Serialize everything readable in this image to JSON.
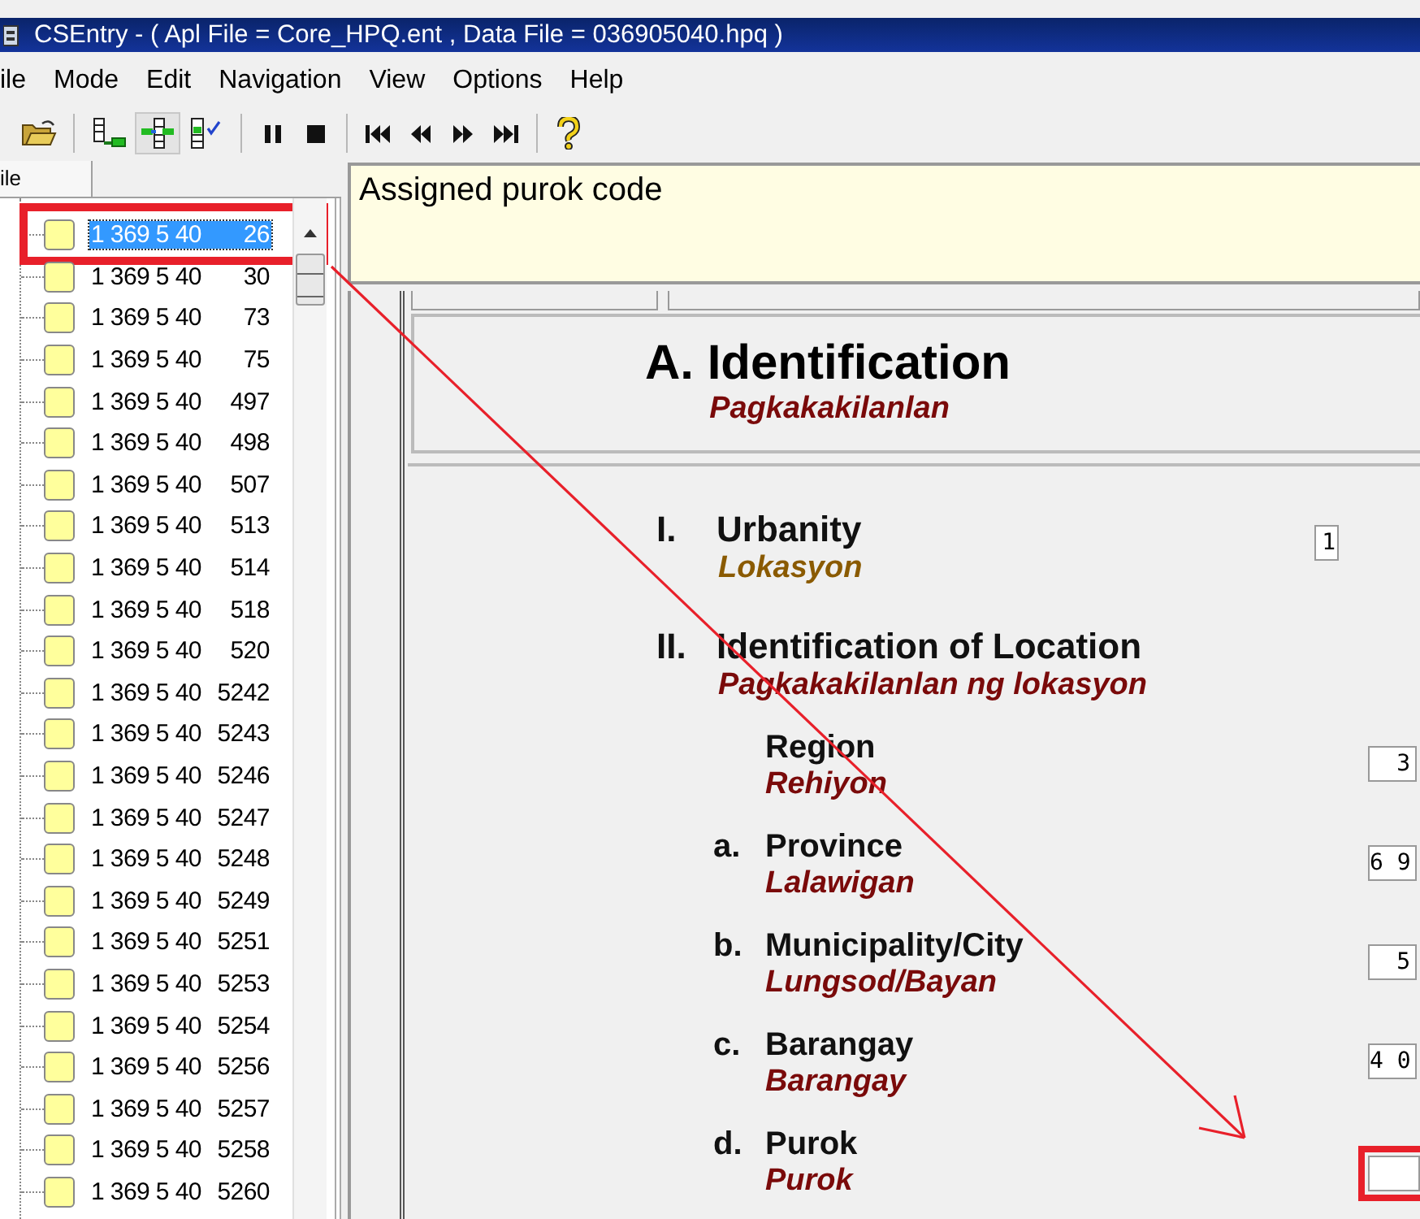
{
  "window": {
    "title": "CSEntry - ( Apl File = Core_HPQ.ent , Data File = 036905040.hpq )"
  },
  "menu": [
    "ile",
    "Mode",
    "Edit",
    "Navigation",
    "View",
    "Options",
    "Help"
  ],
  "toolbar": [
    {
      "kind": "open",
      "pressed": false
    },
    {
      "kind": "sep"
    },
    {
      "kind": "add-case",
      "pressed": false
    },
    {
      "kind": "tree",
      "pressed": true
    },
    {
      "kind": "verify",
      "pressed": false
    },
    {
      "kind": "sep"
    },
    {
      "kind": "pause",
      "pressed": false
    },
    {
      "kind": "stop",
      "pressed": false
    },
    {
      "kind": "sep"
    },
    {
      "kind": "first",
      "pressed": false
    },
    {
      "kind": "prev",
      "pressed": false
    },
    {
      "kind": "next",
      "pressed": false
    },
    {
      "kind": "last",
      "pressed": false
    },
    {
      "kind": "sep"
    },
    {
      "kind": "help",
      "pressed": false
    }
  ],
  "case_tree": {
    "tab": "ile",
    "items": [
      {
        "prefix": "1 369 5 40",
        "number": "26",
        "selected": true,
        "highlighted": true
      },
      {
        "prefix": "1 369 5 40",
        "number": "30",
        "selected": false,
        "highlighted": false
      },
      {
        "prefix": "1 369 5 40",
        "number": "73",
        "selected": false,
        "highlighted": false
      },
      {
        "prefix": "1 369 5 40",
        "number": "75",
        "selected": false,
        "highlighted": false
      },
      {
        "prefix": "1 369 5 40",
        "number": "497",
        "selected": false,
        "highlighted": false
      },
      {
        "prefix": "1 369 5 40",
        "number": "498",
        "selected": false,
        "highlighted": false
      },
      {
        "prefix": "1 369 5 40",
        "number": "507",
        "selected": false,
        "highlighted": false
      },
      {
        "prefix": "1 369 5 40",
        "number": "513",
        "selected": false,
        "highlighted": false
      },
      {
        "prefix": "1 369 5 40",
        "number": "514",
        "selected": false,
        "highlighted": false
      },
      {
        "prefix": "1 369 5 40",
        "number": "518",
        "selected": false,
        "highlighted": false
      },
      {
        "prefix": "1 369 5 40",
        "number": "520",
        "selected": false,
        "highlighted": false
      },
      {
        "prefix": "1 369 5 40",
        "number": "5242",
        "selected": false,
        "highlighted": false
      },
      {
        "prefix": "1 369 5 40",
        "number": "5243",
        "selected": false,
        "highlighted": false
      },
      {
        "prefix": "1 369 5 40",
        "number": "5246",
        "selected": false,
        "highlighted": false
      },
      {
        "prefix": "1 369 5 40",
        "number": "5247",
        "selected": false,
        "highlighted": false
      },
      {
        "prefix": "1 369 5 40",
        "number": "5248",
        "selected": false,
        "highlighted": false
      },
      {
        "prefix": "1 369 5 40",
        "number": "5249",
        "selected": false,
        "highlighted": false
      },
      {
        "prefix": "1 369 5 40",
        "number": "5251",
        "selected": false,
        "highlighted": false
      },
      {
        "prefix": "1 369 5 40",
        "number": "5253",
        "selected": false,
        "highlighted": false
      },
      {
        "prefix": "1 369 5 40",
        "number": "5254",
        "selected": false,
        "highlighted": false
      },
      {
        "prefix": "1 369 5 40",
        "number": "5256",
        "selected": false,
        "highlighted": false
      },
      {
        "prefix": "1 369 5 40",
        "number": "5257",
        "selected": false,
        "highlighted": false
      },
      {
        "prefix": "1 369 5 40",
        "number": "5258",
        "selected": false,
        "highlighted": false
      },
      {
        "prefix": "1 369 5 40",
        "number": "5260",
        "selected": false,
        "highlighted": false
      }
    ]
  },
  "help_text": "Assigned purok code",
  "form": {
    "section": {
      "marker": "A.",
      "title": "Identification",
      "subtitle": "Pagkakakilanlan"
    },
    "items": [
      {
        "kind": "major",
        "marker": "I.",
        "label": "Urbanity",
        "translation": "Lokasyon",
        "color": "#8a5a00",
        "value": "1",
        "highlighted": false
      },
      {
        "kind": "major",
        "marker": "II.",
        "label": "Identification of Location",
        "translation": "Pagkakakilanlan ng lokasyon",
        "color": "#7a0a0a"
      },
      {
        "kind": "sub",
        "label": "Region",
        "translation": "Rehiyon",
        "color": "#7a0a0a",
        "value": "3",
        "highlighted": false
      },
      {
        "kind": "sub",
        "marker": "a.",
        "label": "Province",
        "translation": "Lalawigan",
        "color": "#7a0a0a",
        "value": "6 9",
        "highlighted": false
      },
      {
        "kind": "sub",
        "marker": "b.",
        "label": "Municipality/City",
        "translation": "Lungsod/Bayan",
        "color": "#7a0a0a",
        "value": "5",
        "highlighted": false
      },
      {
        "kind": "sub",
        "marker": "c.",
        "label": "Barangay",
        "translation": "Barangay",
        "color": "#7a0a0a",
        "value": "4 0",
        "highlighted": false
      },
      {
        "kind": "sub",
        "marker": "d.",
        "label": "Purok",
        "translation": "Purok",
        "color": "#7a0a0a",
        "value": "",
        "highlighted": true
      }
    ]
  }
}
